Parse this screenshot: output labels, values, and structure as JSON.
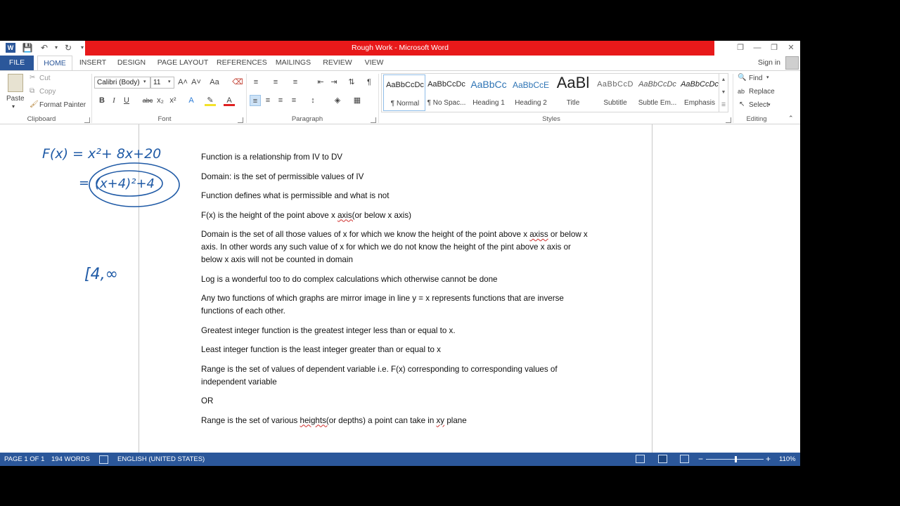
{
  "window": {
    "title": "Rough Work -  Microsoft Word",
    "title_bar_color": "#e8191a",
    "accent": "#2b579a",
    "app_icon": "W",
    "window_buttons": [
      "?",
      "❐",
      "—",
      "❐",
      "✕"
    ]
  },
  "tabs": {
    "file": "FILE",
    "items": [
      "HOME",
      "INSERT",
      "DESIGN",
      "PAGE LAYOUT",
      "REFERENCES",
      "MAILINGS",
      "REVIEW",
      "VIEW"
    ],
    "active": "HOME",
    "signin": "Sign in"
  },
  "ribbon": {
    "clipboard": {
      "paste": "Paste",
      "cut": "Cut",
      "copy": "Copy",
      "format_painter": "Format Painter",
      "label": "Clipboard"
    },
    "font": {
      "font_name": "Calibri (Body)",
      "font_size": "11",
      "bold": "B",
      "italic": "I",
      "underline": "U",
      "strikethrough": "abc",
      "subscript": "x₂",
      "superscript": "x²",
      "grow": "A˄",
      "shrink": "A˅",
      "case": "Aa",
      "label": "Font"
    },
    "paragraph": {
      "label": "Paragraph"
    },
    "styles": {
      "label": "Styles",
      "items": [
        {
          "sample": "AaBbCcDc",
          "name": "¶ Normal"
        },
        {
          "sample": "AaBbCcDc",
          "name": "¶ No Spac..."
        },
        {
          "sample": "AaBbCc",
          "name": "Heading 1"
        },
        {
          "sample": "AaBbCcE",
          "name": "Heading 2"
        },
        {
          "sample": "AaBl",
          "name": "Title"
        },
        {
          "sample": "AaBbCcD",
          "name": "Subtitle"
        },
        {
          "sample": "AaBbCcDc",
          "name": "Subtle Em..."
        },
        {
          "sample": "AaBbCcDc",
          "name": "Emphasis"
        }
      ]
    },
    "editing": {
      "label": "Editing",
      "find": "Find",
      "replace": "Replace",
      "select": "Select"
    }
  },
  "document": {
    "paragraphs": [
      "Function is a relationship from IV to DV",
      "Domain: is the set of permissible values of IV",
      "Function defines what is permissible and what is not",
      "F(x) is the height of the point above x axis(or below x axis)",
      "Domain is the set of all those values of x for which we know the height of the point above x axiss or below x axis. In other words any such value of x for which we do not know the height of the pint above x axis or below x axis will not be counted in domain",
      "Log is a wonderful too to do complex calculations which otherwise cannot be done",
      "Any two functions of which graphs are mirror image in line y = x represents functions that are inverse functions of each other.",
      "Greatest integer function is the greatest integer less than or equal to x.",
      "Least integer function is the least integer greater than or equal to x",
      "Range is the set of values of dependent variable i.e. F(x) corresponding to corresponding values of independent variable",
      "OR",
      "Range is the set of various heights(or depths) a point can take in xy plane"
    ],
    "p4_parts": [
      "F(x) is the height of the point above x ",
      "axis(",
      "or below x axis)"
    ],
    "p5_parts": [
      "Domain is the set of all those values of x for which we know the height of the point above x ",
      "axiss",
      " or below x axis. In other words any such value of x for which we do not know the height of the pint above x axis or below x axis will not be counted in domain"
    ],
    "p12_parts": [
      "Range is the set of various ",
      "heights(",
      "or depths) a point can take in ",
      "xy",
      " plane"
    ]
  },
  "ink": {
    "color": "#1f5aa6",
    "line1": "F(x) = x²+ 8x+20",
    "line2_prefix": "=",
    "line2": "(x+4)²+4",
    "line3": "[4,∞"
  },
  "status": {
    "page": "PAGE 1 OF 1",
    "words": "194 WORDS",
    "language": "ENGLISH (UNITED STATES)",
    "zoom": "110%",
    "zoom_level_percent": 110
  }
}
